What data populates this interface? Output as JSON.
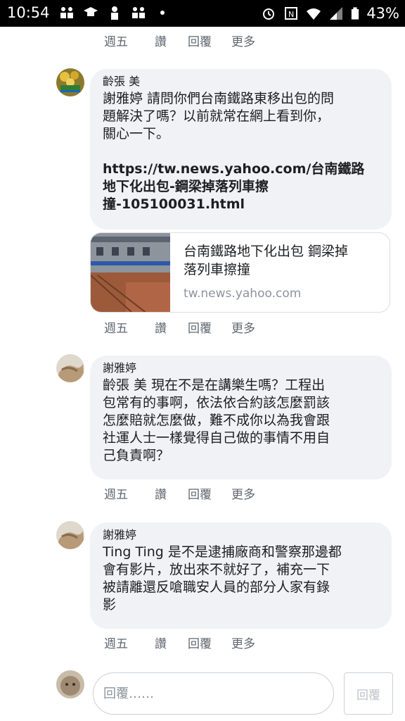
{
  "status_bar": {
    "time": "10:54",
    "battery": "43%",
    "icons": [
      "people-icon",
      "graduation-cap-icon",
      "person-icon",
      "people-icon",
      "dot-icon",
      "alarm-icon",
      "nfc-icon",
      "wifi-icon",
      "signal-icon",
      "battery-icon"
    ]
  },
  "action_labels": {
    "day": "週五",
    "like": "讚",
    "reply": "回覆",
    "more": "更多"
  },
  "comments": [
    {
      "author": "齡張 美",
      "lines": [
        "謝雅婷 請問你們台南鐵路東移出包的問",
        "題解決了嗎？以前就常在網上看到你，",
        "關心一下。"
      ],
      "link_lines": [
        "https://tw.news.yahoo.com/台南鐵路",
        "地下化出包-鋼梁掉落列車擦",
        "撞-105100031.html"
      ]
    },
    {
      "author": "謝雅婷",
      "lines": [
        "齡張 美 現在不是在講樂生嗎？工程出",
        "包常有的事啊，依法依合約該怎麼罰該",
        "怎麼賠就怎麼做，難不成你以為我會跟",
        "社運人士一樣覺得自己做的事情不用自",
        "己負責啊？"
      ]
    },
    {
      "author": "謝雅婷",
      "lines": [
        "Ting Ting 是不是逮捕廠商和警察那邊都",
        "會有影片，放出來不就好了，補充一下",
        "被請離還反嗆職安人員的部分人家有錄",
        "影"
      ]
    }
  ],
  "link_preview": {
    "title_lines": [
      "台南鐵路地下化出包 鋼梁掉",
      "落列車擦撞"
    ],
    "domain": "tw.news.yahoo.com"
  },
  "reply_box": {
    "placeholder": "回覆……",
    "button": "回覆"
  }
}
